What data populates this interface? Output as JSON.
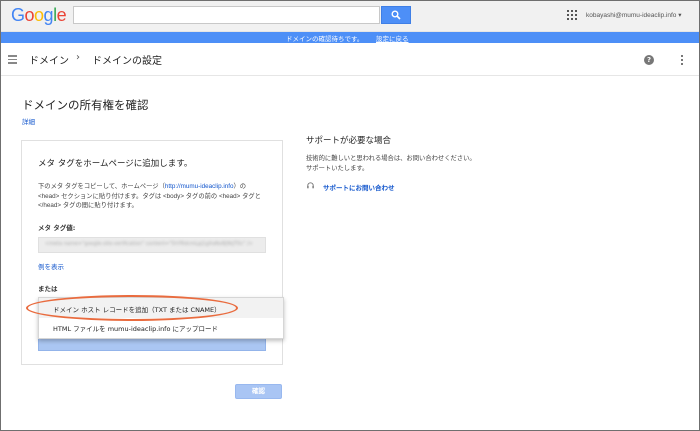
{
  "topbar": {
    "logo": [
      "G",
      "o",
      "o",
      "g",
      "l",
      "e"
    ],
    "logo_colors": [
      "#4285f4",
      "#ea4335",
      "#fbbc05",
      "#4285f4",
      "#34a853",
      "#ea4335"
    ],
    "search_placeholder": "",
    "account": "kobayashi@mumu-ideaclip.info ▾",
    "search_icon": "search-icon",
    "apps_icon": "apps-grid-icon"
  },
  "notice": {
    "text": "ドメインの確認待ちです。",
    "link": "設定に戻る",
    "color": "#4d8ff7"
  },
  "header": {
    "crumb_domain": "ドメイン",
    "separator": "›",
    "crumb_settings": "ドメインの設定",
    "help_icon": "help-icon",
    "more_icon": "more-vert-icon"
  },
  "page": {
    "title": "ドメインの所有権を確認",
    "details_link": "詳細"
  },
  "card": {
    "title": "メタ タグをホームページに追加します。",
    "desc_before": "下のメタ タグをコピーして、ホームページ（",
    "desc_link": "http://mumu-ideaclip.info",
    "desc_after": "）の <head> セクションに貼り付けます。タグは <body> タグの前の <head> タグと </head> タグの間に貼り付けます。",
    "meta_label": "メタ タグ値:",
    "meta_value": "<meta name=\"google-site-verification\" content=\"5hYRdcmLpj1gXaNx8j9kJT0c\" />",
    "example_link": "例を表示",
    "or_label": "または",
    "menu_options": [
      "ドメイン ホスト レコードを追加（TXT または CNAME）",
      "HTML ファイルを mumu-ideaclip.info にアップロード"
    ],
    "selected_option": "ドメイン ホスト レコードを追加（TXT または CNAME）",
    "verify_button": "確認",
    "highlight_color": "#e96b3e"
  },
  "support": {
    "title": "サポートが必要な場合",
    "desc": "技術的に難しいと思われる場合は、お問い合わせください。サポートいたします。",
    "link": "サポートにお問い合わせ",
    "link_icon": "headset-icon"
  }
}
